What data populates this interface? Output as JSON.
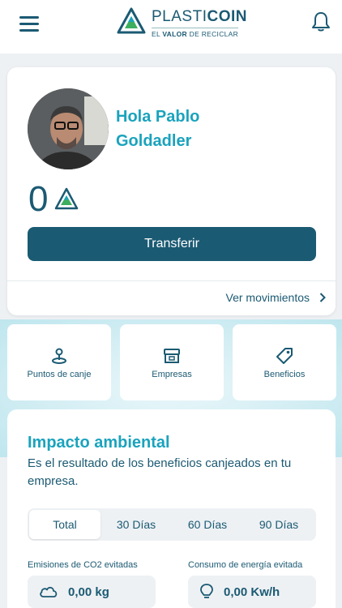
{
  "header": {
    "brand_light": "PLASTI",
    "brand_bold": "COIN",
    "tagline_pre": "EL ",
    "tagline_bold": "VALOR",
    "tagline_post": " DE RECICLAR",
    "menu_icon": "hamburger-icon",
    "bell_icon": "bell-icon"
  },
  "profile": {
    "greeting_line1": "Hola Pablo",
    "greeting_line2": "Goldadler",
    "balance": "0",
    "transfer_label": "Transferir",
    "movements_label": "Ver movimientos"
  },
  "quick_actions": [
    {
      "label": "Puntos de canje",
      "icon": "map-pin-icon"
    },
    {
      "label": "Empresas",
      "icon": "store-icon"
    },
    {
      "label": "Beneficios",
      "icon": "tag-icon"
    }
  ],
  "impact": {
    "title": "Impacto ambiental",
    "description": "Es el resultado de los beneficios canjeados en tu empresa.",
    "tabs": [
      "Total",
      "30 Días",
      "60 Días",
      "90 Días"
    ],
    "active_tab": "Total",
    "metrics": [
      {
        "label": "Emisiones de CO2 evitadas",
        "value": "0,00 kg",
        "icon": "cloud-icon"
      },
      {
        "label": "Consumo de energía evitada",
        "value": "0,00 Kw/h",
        "icon": "lightbulb-icon"
      }
    ]
  },
  "colors": {
    "primary": "#1b5a73",
    "accent": "#1aa3bd",
    "logo_green": "#3dae5e"
  }
}
